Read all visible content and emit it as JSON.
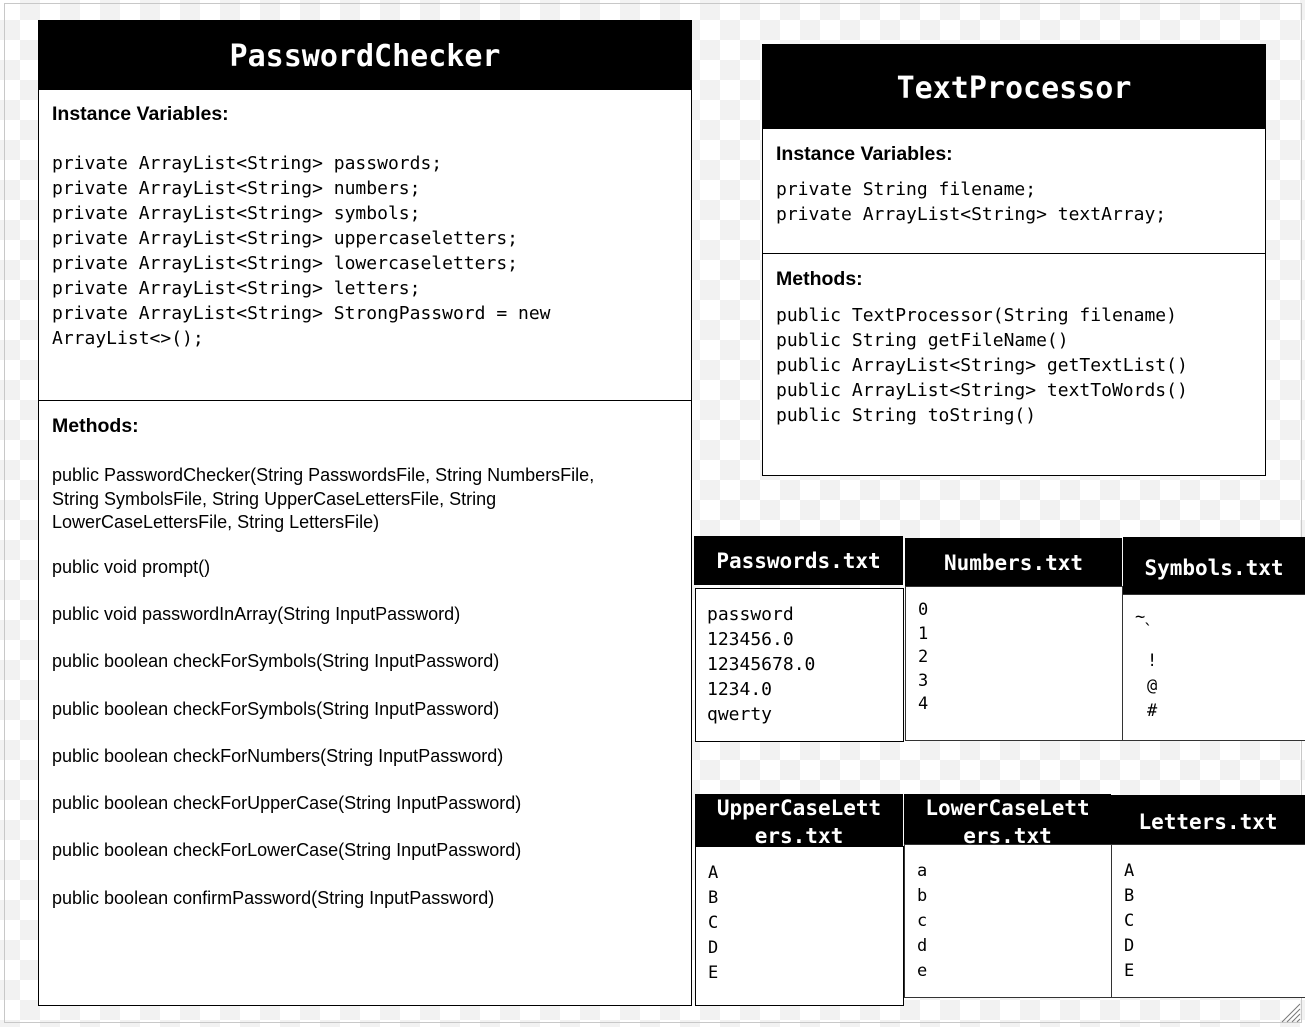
{
  "password_checker": {
    "title": "PasswordChecker",
    "instance_vars_title": "Instance Variables:",
    "instance_vars": [
      "private ArrayList<String> passwords;",
      "private ArrayList<String> numbers;",
      "private ArrayList<String> symbols;",
      "private ArrayList<String> uppercaseletters;",
      "private ArrayList<String> lowercaseletters;",
      "private ArrayList<String> letters;",
      "private ArrayList<String> StrongPassword = new",
      "ArrayList<>();"
    ],
    "methods_title": "Methods:",
    "constructor_lines": [
      "public PasswordChecker(String PasswordsFile, String NumbersFile,",
      "String SymbolsFile, String UpperCaseLettersFile, String",
      "LowerCaseLettersFile, String LettersFile)"
    ],
    "methods": [
      "public void prompt()",
      "public void passwordInArray(String InputPassword)",
      "public boolean checkForSymbols(String InputPassword)",
      "public boolean checkForSymbols(String InputPassword)",
      "public boolean checkForNumbers(String InputPassword)",
      "public boolean checkForUpperCase(String InputPassword)",
      "public boolean checkForLowerCase(String InputPassword)",
      "public boolean confirmPassword(String InputPassword)"
    ]
  },
  "text_processor": {
    "title": "TextProcessor",
    "instance_vars_title": "Instance Variables:",
    "instance_vars": [
      "private String filename;",
      "private ArrayList<String> textArray;"
    ],
    "methods_title": "Methods:",
    "methods": [
      "public TextProcessor(String filename)",
      "public String getFileName()",
      "public ArrayList<String> getTextList()",
      "public ArrayList<String> textToWords()",
      "public String toString()"
    ]
  },
  "files": {
    "passwords": {
      "title": "Passwords.txt",
      "lines": [
        "password",
        "123456.0",
        "12345678.0",
        "1234.0",
        "qwerty"
      ]
    },
    "numbers": {
      "title": "Numbers.txt",
      "lines": [
        "0",
        "1",
        "2",
        "3",
        "4"
      ]
    },
    "symbols": {
      "title": "Symbols.txt",
      "lines": [
        "~",
        "`",
        "!",
        "@",
        "#"
      ]
    },
    "uppercase": {
      "title_lines": [
        "UpperCaseLett",
        "ers.txt"
      ],
      "lines": [
        "A",
        "B",
        "C",
        "D",
        "E"
      ]
    },
    "lowercase": {
      "title_lines": [
        "LowerCaseLett",
        "ers.txt"
      ],
      "lines": [
        "a",
        "b",
        "c",
        "d",
        "e"
      ]
    },
    "letters": {
      "title": "Letters.txt",
      "lines": [
        "A",
        "B",
        "C",
        "D",
        "E"
      ]
    }
  }
}
